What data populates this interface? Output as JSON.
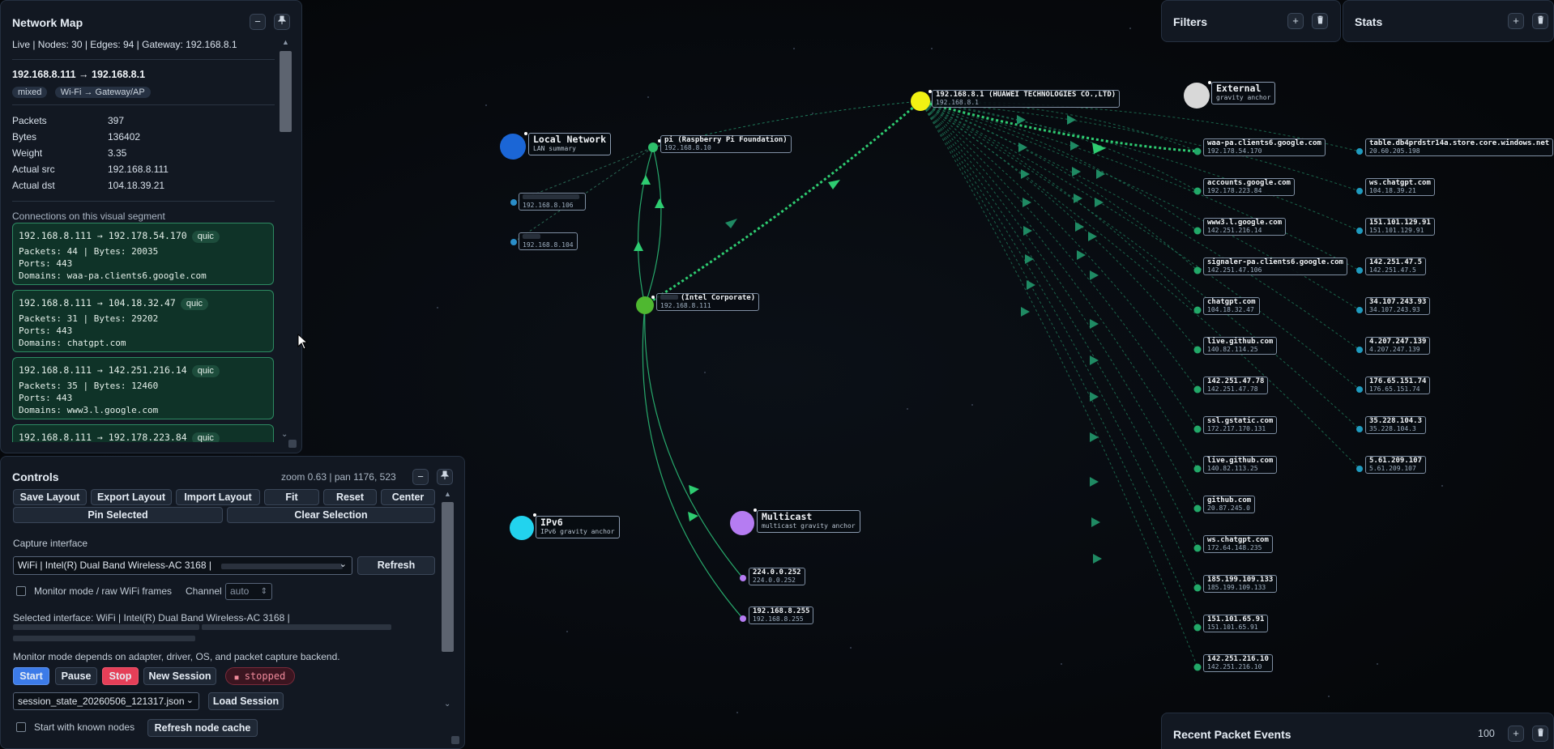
{
  "network_panel": {
    "title": "Network Map",
    "status_line": "Live | Nodes: 30 | Edges: 94 | Gateway: 192.168.8.1",
    "selected_edge": "192.168.8.111 → 192.168.8.1",
    "tags": [
      "mixed",
      "Wi-Fi → Gateway/AP"
    ],
    "stats": [
      {
        "key": "Packets",
        "value": "397"
      },
      {
        "key": "Bytes",
        "value": "136402"
      },
      {
        "key": "Weight",
        "value": "3.35"
      },
      {
        "key": "Actual src",
        "value": "192.168.8.111"
      },
      {
        "key": "Actual dst",
        "value": "104.18.39.21"
      }
    ],
    "connections_title": "Connections on this visual segment",
    "connections": [
      {
        "header": "192.168.8.111 → 192.178.54.170",
        "proto": "quic",
        "line1": "Packets: 44 | Bytes: 20035",
        "line2": "Ports: 443",
        "line3": "Domains: waa-pa.clients6.google.com"
      },
      {
        "header": "192.168.8.111 → 104.18.32.47",
        "proto": "quic",
        "line1": "Packets: 31 | Bytes: 29202",
        "line2": "Ports: 443",
        "line3": "Domains: chatgpt.com"
      },
      {
        "header": "192.168.8.111 → 142.251.216.14",
        "proto": "quic",
        "line1": "Packets: 35 | Bytes: 12460",
        "line2": "Ports: 443",
        "line3": "Domains: www3.l.google.com"
      },
      {
        "header": "192.168.8.111 → 192.178.223.84",
        "proto": "quic",
        "line1": "",
        "line2": "",
        "line3": ""
      }
    ]
  },
  "controls": {
    "title": "Controls",
    "zoom_pan": "zoom 0.63 | pan 1176, 523",
    "buttons_row1": [
      "Save Layout",
      "Export Layout",
      "Import Layout",
      "Fit",
      "Reset",
      "Center"
    ],
    "pin_selected": "Pin Selected",
    "clear_selection": "Clear Selection",
    "capture_label": "Capture interface",
    "interface_value": "WiFi | Intel(R) Dual Band Wireless-AC 3168 |",
    "refresh": "Refresh",
    "monitor_mode": "Monitor mode / raw WiFi frames",
    "channel_label": "Channel",
    "channel_value": "auto",
    "selected_interface": "Selected interface: WiFi | Intel(R) Dual Band Wireless-AC 3168 |",
    "monitor_note": "Monitor mode depends on adapter, driver, OS, and packet capture backend.",
    "start": "Start",
    "pause": "Pause",
    "stop": "Stop",
    "new_session": "New Session",
    "status": "stopped",
    "session_file": "session_state_20260506_121317.json",
    "load_session": "Load Session",
    "start_known": "Start with known nodes",
    "refresh_cache": "Refresh node cache"
  },
  "filters": {
    "title": "Filters"
  },
  "stats_panel": {
    "title": "Stats"
  },
  "events": {
    "title": "Recent Packet Events",
    "count": "100"
  },
  "icons": {
    "minimize": "−",
    "pin": "📌",
    "add": "+",
    "delete": "🗑",
    "chevron": "⌄"
  },
  "graph": {
    "gravity": [
      {
        "id": "local",
        "name": "Local Network",
        "sub": "LAN summary",
        "color": "#1b66d6"
      },
      {
        "id": "external",
        "name": "External",
        "sub": "gravity anchor",
        "color": "#d8d8d8"
      },
      {
        "id": "ipv6",
        "name": "IPv6",
        "sub": "IPv6 gravity anchor",
        "color": "#22d3ee"
      },
      {
        "id": "multicast",
        "name": "Multicast",
        "sub": "multicast gravity anchor",
        "color": "#b57cf2"
      }
    ],
    "gateway": {
      "name": "192.168.8.1 (HUAWEI TECHNOLOGIES CO.,LTD)",
      "ip": "192.168.8.1",
      "color": "#f2f213"
    },
    "local_nodes": [
      {
        "name": "pi (Raspberry Pi Foundation)",
        "ip": "192.168.8.10"
      },
      {
        "name": "(Intel Corporate)",
        "ip": "192.168.8.111"
      },
      {
        "name": "",
        "ip": "192.168.8.106"
      },
      {
        "name": "",
        "ip": "192.168.8.104"
      }
    ],
    "multicast_nodes": [
      {
        "name": "224.0.0.252",
        "ip": "224.0.0.252"
      },
      {
        "name": "192.168.8.255",
        "ip": "192.168.8.255"
      }
    ],
    "external_col1": [
      {
        "name": "waa-pa.clients6.google.com",
        "ip": "192.178.54.170"
      },
      {
        "name": "accounts.google.com",
        "ip": "192.178.223.84"
      },
      {
        "name": "www3.l.google.com",
        "ip": "142.251.216.14"
      },
      {
        "name": "signaler-pa.clients6.google.com",
        "ip": "142.251.47.106"
      },
      {
        "name": "chatgpt.com",
        "ip": "104.18.32.47"
      },
      {
        "name": "live.github.com",
        "ip": "140.82.114.25"
      },
      {
        "name": "142.251.47.78",
        "ip": "142.251.47.78"
      },
      {
        "name": "ssl.gstatic.com",
        "ip": "172.217.170.131"
      },
      {
        "name": "live.github.com",
        "ip": "140.82.113.25"
      },
      {
        "name": "github.com",
        "ip": "20.87.245.0"
      },
      {
        "name": "ws.chatgpt.com",
        "ip": "172.64.148.235"
      },
      {
        "name": "185.199.109.133",
        "ip": "185.199.109.133"
      },
      {
        "name": "151.101.65.91",
        "ip": "151.101.65.91"
      },
      {
        "name": "142.251.216.10",
        "ip": "142.251.216.10"
      }
    ],
    "external_col2": [
      {
        "name": "table.db4prdstr14a.store.core.windows.net",
        "ip": "20.60.205.198"
      },
      {
        "name": "ws.chatgpt.com",
        "ip": "104.18.39.21"
      },
      {
        "name": "151.101.129.91",
        "ip": "151.101.129.91"
      },
      {
        "name": "142.251.47.5",
        "ip": "142.251.47.5"
      },
      {
        "name": "34.107.243.93",
        "ip": "34.107.243.93"
      },
      {
        "name": "4.207.247.139",
        "ip": "4.207.247.139"
      },
      {
        "name": "176.65.151.74",
        "ip": "176.65.151.74"
      },
      {
        "name": "35.228.104.3",
        "ip": "35.228.104.3"
      },
      {
        "name": "5.61.209.107",
        "ip": "5.61.209.107"
      }
    ]
  }
}
